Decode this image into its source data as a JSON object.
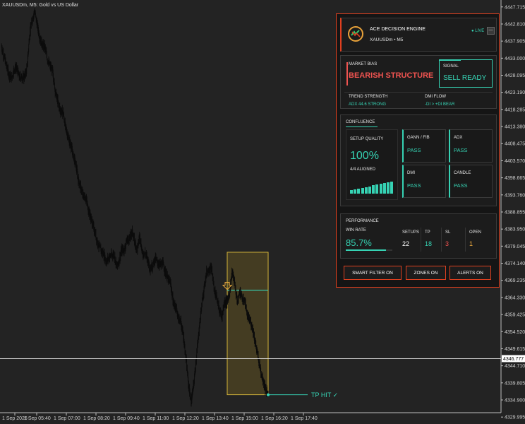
{
  "window": {
    "title": "XAUUSDm, M5:  Gold vs US Dollar"
  },
  "chart_data": {
    "type": "candlestick",
    "symbol": "XAUUSDm",
    "timeframe": "M5",
    "y_ticks": [
      "4447.715",
      "4442.810",
      "4437.905",
      "4433.000",
      "4428.095",
      "4423.190",
      "4418.285",
      "4413.380",
      "4408.475",
      "4403.570",
      "4398.665",
      "4393.760",
      "4388.855",
      "4383.950",
      "4379.045",
      "4374.140",
      "4369.235",
      "4364.330",
      "4359.425",
      "4354.520",
      "4349.615",
      "4344.710",
      "4339.805",
      "4334.900",
      "4329.995"
    ],
    "x_ticks": [
      "1 Sep 2026",
      "1 Sep 05:40",
      "1 Sep 07:00",
      "1 Sep 08:20",
      "1 Sep 09:40",
      "1 Sep 11:00",
      "1 Sep 12:20",
      "1 Sep 13:40",
      "1 Sep 15:00",
      "1 Sep 16:20",
      "1 Sep 17:40"
    ],
    "current_price": "4346.777",
    "ylim": [
      4328.0,
      4449.7
    ],
    "price_path": [
      4436.5,
      4433.6,
      4430.9,
      4428.3,
      4427.3,
      4429.9,
      4430.1,
      4427.6,
      4427.5,
      4427.6,
      4430.1,
      4439.6,
      4443.9,
      4446.6,
      4442.5,
      4438.8,
      4436.8,
      4436.2,
      4432.6,
      4430.7,
      4429.3,
      4423.8,
      4420.6,
      4417.9,
      4417.6,
      4413.3,
      4410.4,
      4408.3,
      4405.2,
      4402.7,
      4398.3,
      4395.7,
      4393.3,
      4392.8,
      4389.4,
      4386.9,
      4384.3,
      4381.6,
      4379.0,
      4377.7,
      4376.6,
      4374.6,
      4375.9,
      4376.4,
      4376.7,
      4373.1,
      4375.1,
      4378.0,
      4378.0,
      4380.9,
      4381.0,
      4383.4,
      4380.2,
      4378.2,
      4382.1,
      4376.8,
      4377.1,
      4375.4,
      4372.7,
      4373.5,
      4375.6,
      4374.2,
      4373.7,
      4374.0,
      4371.5,
      4369.6,
      4368.3,
      4363.0,
      4361.4,
      4358.8,
      4357.2,
      4353.2,
      4346.8,
      4339.2,
      4334.1,
      4339.2,
      4346.8,
      4354.3,
      4361.4,
      4366.7,
      4371.5,
      4372.5,
      4372.5,
      4366.6,
      4364.5,
      4360.5,
      4358.8,
      4362.9,
      4363.1,
      4365.6,
      4371.8,
      4368.4,
      4362.8,
      4366.2,
      4363.7,
      4363.2,
      4358.8,
      4357.5,
      4355.6,
      4351.4,
      4347.6,
      4343.7,
      4340.8,
      4338.0,
      4336.4
    ],
    "trade_box": {
      "top_price": 4377.3,
      "bottom_price": 4336.4,
      "entry_price": 4366.4,
      "tp_price": 4336.4
    },
    "tp_label": "TP HIT ✓"
  },
  "panel": {
    "title": "ACE DECISION ENGINE",
    "subtitle": "XAUUSDm  •  M5",
    "status": "LIVE",
    "minimize_symbol": "—",
    "market_bias": {
      "label": "MARKET BIAS",
      "value": "BEARISH STRUCTURE"
    },
    "signal": {
      "label": "SIGNAL",
      "value": "SELL READY"
    },
    "trend_strength": {
      "label": "TREND STRENGTH",
      "value": "ADX 44.6  STRONG"
    },
    "dmi_flow": {
      "label": "DMI FLOW",
      "value": "-DI > +DI BEAR"
    },
    "confluence": {
      "label": "CONFLUENCE",
      "setup_quality_label": "SETUP QUALITY",
      "setup_quality_value": "100%",
      "aligned": "4/4 ALIGNED",
      "bar_levels": [
        0.28,
        0.34,
        0.4,
        0.46,
        0.52,
        0.58,
        0.64,
        0.7,
        0.76,
        0.82,
        0.88,
        0.94
      ],
      "checks": [
        {
          "name": "GANN / FIB",
          "status": "PASS"
        },
        {
          "name": "ADX",
          "status": "PASS"
        },
        {
          "name": "DMI",
          "status": "PASS"
        },
        {
          "name": "CANDLE",
          "status": "PASS"
        }
      ]
    },
    "performance": {
      "label": "PERFORMANCE",
      "win_rate_label": "WIN RATE",
      "win_rate_value": "85.7%",
      "win_rate_fraction": 0.857,
      "stats": [
        {
          "label": "SETUPS",
          "value": "22",
          "color": "#ffffff"
        },
        {
          "label": "TP",
          "value": "18",
          "color": "#36d3b4"
        },
        {
          "label": "SL",
          "value": "3",
          "color": "#ef5350"
        },
        {
          "label": "OPEN",
          "value": "1",
          "color": "#f5b041"
        }
      ]
    },
    "buttons": {
      "smart_filter": "SMART FILTER ON",
      "zones": "ZONES ON",
      "alerts": "ALERTS ON"
    }
  },
  "colors": {
    "accent": "#e0401f",
    "teal": "#36d3b4",
    "bearish": "#ef5350",
    "gold": "#f5b041"
  }
}
